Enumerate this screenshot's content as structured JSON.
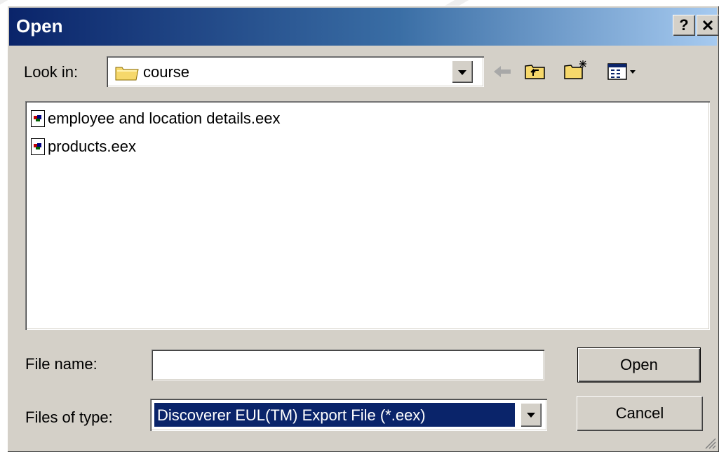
{
  "window": {
    "title": "Open",
    "help_label": "?",
    "close_label": "✕"
  },
  "look_in": {
    "label": "Look in:",
    "value": "course",
    "icon": "folder-icon"
  },
  "toolbar": {
    "icons": [
      "back-arrow-icon",
      "up-one-level-icon",
      "create-new-folder-icon",
      "view-menu-icon"
    ]
  },
  "files": [
    {
      "name": "employee and location details.eex",
      "icon": "eex-file-icon"
    },
    {
      "name": "products.eex",
      "icon": "eex-file-icon"
    }
  ],
  "file_name": {
    "label": "File name:",
    "value": ""
  },
  "files_of_type": {
    "label": "Files of type:",
    "value": "Discoverer EUL(TM) Export File (*.eex)"
  },
  "buttons": {
    "open": "Open",
    "cancel": "Cancel"
  },
  "colors": {
    "title_start": "#0a246a",
    "title_end": "#a6caf0",
    "selection": "#0a246a",
    "face": "#d4d0c8"
  }
}
